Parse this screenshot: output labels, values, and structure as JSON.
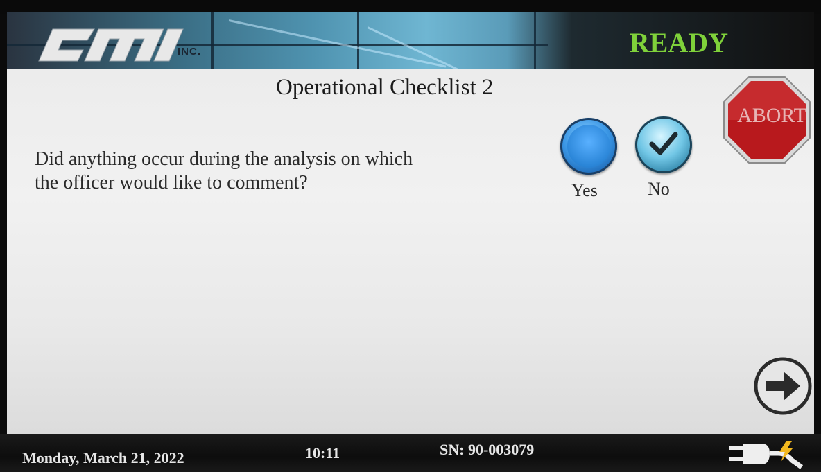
{
  "header": {
    "logo_text": "CMI",
    "logo_suffix": "INC.",
    "status": "READY",
    "status_color": "#7fd13a"
  },
  "main": {
    "title": "Operational Checklist 2",
    "question_lines": [
      "Did anything occur during the analysis on which",
      "the officer would like to comment?"
    ],
    "options": [
      {
        "label": "Yes",
        "selected": false
      },
      {
        "label": "No",
        "selected": true
      }
    ],
    "abort_label": "ABORT",
    "next_icon": "arrow-right-icon"
  },
  "footer": {
    "date": "Monday, March 21, 2022",
    "time": "10:11",
    "serial": "SN: 90-003079",
    "power_icon": "ac-power-plug-icon"
  }
}
